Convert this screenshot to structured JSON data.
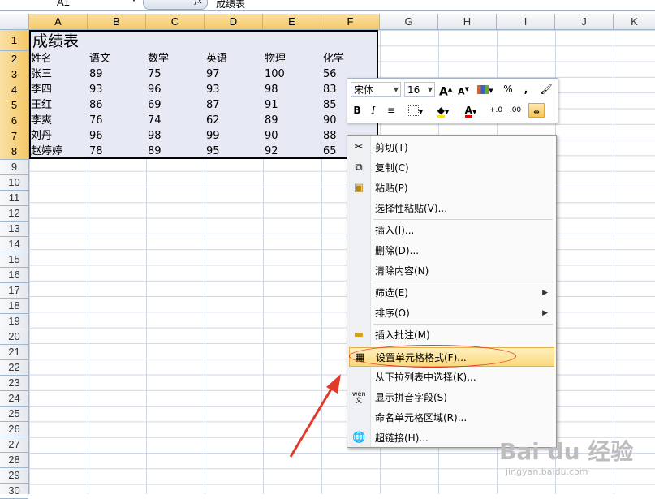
{
  "formula_bar": {
    "name_box": "A1",
    "fx_label": "fx",
    "content": "成绩表"
  },
  "columns": [
    "A",
    "B",
    "C",
    "D",
    "E",
    "F",
    "G",
    "H",
    "I",
    "J",
    "K"
  ],
  "rows": [
    "1",
    "2",
    "3",
    "4",
    "5",
    "6",
    "7",
    "8",
    "9",
    "10",
    "11",
    "12",
    "13",
    "14",
    "15",
    "16",
    "17",
    "18",
    "19",
    "20",
    "21",
    "22",
    "23",
    "24",
    "25",
    "26",
    "27",
    "28",
    "29",
    "30"
  ],
  "sheet": {
    "title": "成绩表",
    "headers": [
      "姓名",
      "语文",
      "数学",
      "英语",
      "物理",
      "化学"
    ],
    "data": [
      [
        "张三",
        "89",
        "75",
        "97",
        "100",
        "56"
      ],
      [
        "李四",
        "93",
        "96",
        "93",
        "98",
        "83"
      ],
      [
        "王红",
        "86",
        "69",
        "87",
        "91",
        "85"
      ],
      [
        "李爽",
        "76",
        "74",
        "62",
        "89",
        "90"
      ],
      [
        "刘丹",
        "96",
        "98",
        "99",
        "90",
        "88"
      ],
      [
        "赵婷婷",
        "78",
        "89",
        "95",
        "92",
        "65"
      ]
    ]
  },
  "mini_toolbar": {
    "font": "宋体",
    "size": "16",
    "bold": "B",
    "italic": "I",
    "percent": "%",
    "comma": ",",
    "grow_font": "A",
    "shrink_font": "A",
    "font_color": "A",
    "inc_decimal": "+.0",
    "dec_decimal": ".00"
  },
  "context_menu": {
    "items": [
      {
        "label": "剪切(T)",
        "icon": "scissors-icon"
      },
      {
        "label": "复制(C)",
        "icon": "copy-icon"
      },
      {
        "label": "粘贴(P)",
        "icon": "paste-icon"
      },
      {
        "label": "选择性粘贴(V)...",
        "icon": ""
      },
      {
        "label": "插入(I)...",
        "icon": ""
      },
      {
        "label": "删除(D)...",
        "icon": ""
      },
      {
        "label": "清除内容(N)",
        "icon": ""
      },
      {
        "label": "筛选(E)",
        "icon": "",
        "submenu": true
      },
      {
        "label": "排序(O)",
        "icon": "",
        "submenu": true
      },
      {
        "label": "插入批注(M)",
        "icon": "comment-icon"
      },
      {
        "label": "设置单元格格式(F)...",
        "icon": "format-cells-icon",
        "highlighted": true
      },
      {
        "label": "从下拉列表中选择(K)...",
        "icon": ""
      },
      {
        "label": "显示拼音字段(S)",
        "icon": "phonetic-icon",
        "icon_text": "wén 文"
      },
      {
        "label": "命名单元格区域(R)...",
        "icon": ""
      },
      {
        "label": "超链接(H)...",
        "icon": "hyperlink-icon"
      }
    ]
  },
  "watermark": {
    "brand": "Bai du 经验",
    "url": "jingyan.baidu.com"
  },
  "colors": {
    "selection_fill": "#e7e9f4",
    "highlight": "#fbd87d",
    "annotation_red": "#e23a2a"
  }
}
